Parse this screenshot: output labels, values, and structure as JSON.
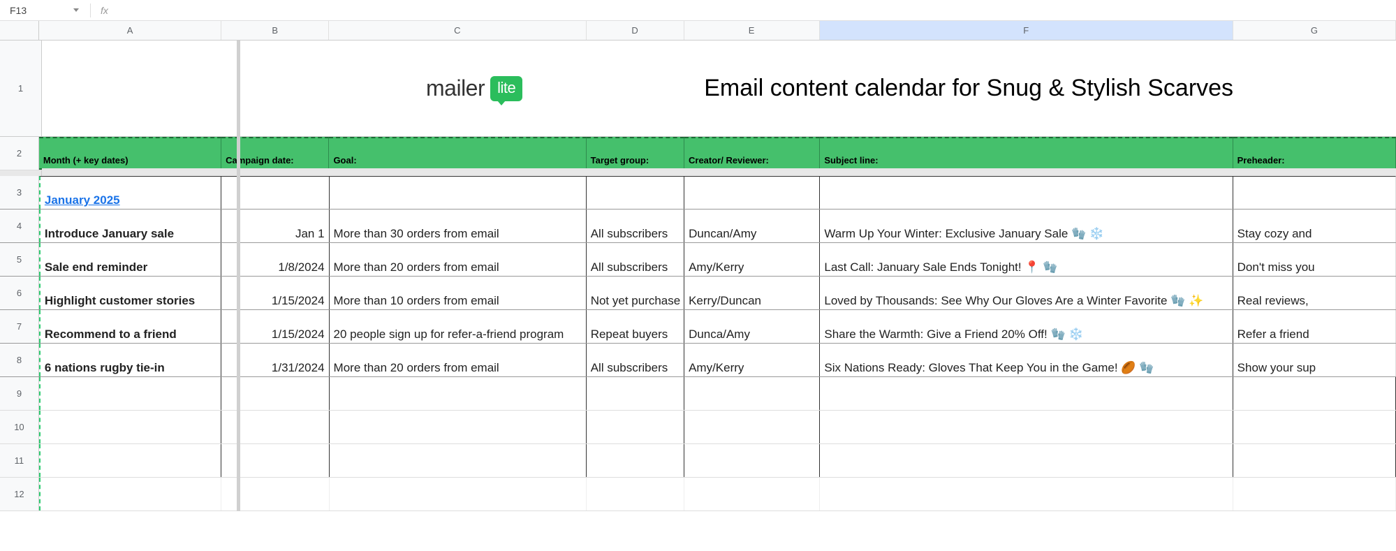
{
  "name_box": "F13",
  "fx_value": "",
  "columns": [
    "A",
    "B",
    "C",
    "D",
    "E",
    "F",
    "G"
  ],
  "selected_column": "F",
  "row_numbers": [
    1,
    2,
    3,
    4,
    5,
    6,
    7,
    8,
    9,
    10,
    11,
    12
  ],
  "title_text": "Email content calendar for Snug & Stylish Scarves",
  "logo": {
    "text_a": "mailer",
    "text_b": "lite"
  },
  "headers": {
    "A": "Month (+ key dates)",
    "B": "Campaign date:",
    "C": "Goal:",
    "D": "Target group:",
    "E": "Creator/ Reviewer:",
    "F": "Subject line:",
    "G": "Preheader:"
  },
  "rows": {
    "r3": {
      "A": "January 2025"
    },
    "r4": {
      "A": "Introduce January sale",
      "B": "Jan 1",
      "C": "More than 30 orders from email",
      "D": "All subscribers",
      "E": "Duncan/Amy",
      "F": "Warm Up Your Winter: Exclusive January Sale 🧤 ❄️",
      "G": "Stay cozy and"
    },
    "r5": {
      "A": "Sale end reminder",
      "B": "1/8/2024",
      "C": "More than 20 orders from email",
      "D": "All subscribers",
      "E": "Amy/Kerry",
      "F": "Last Call: January Sale Ends Tonight! 📍 🧤",
      "G": "Don't miss you"
    },
    "r6": {
      "A": "Highlight customer stories",
      "B": "1/15/2024",
      "C": "More than 10 orders from email",
      "D": "Not yet purchase",
      "E": "Kerry/Duncan",
      "F": "Loved by Thousands: See Why Our Gloves Are a Winter Favorite 🧤 ✨",
      "G": "Real reviews,"
    },
    "r7": {
      "A": "Recommend to a friend",
      "B": "1/15/2024",
      "C": "20 people sign up for refer-a-friend program",
      "D": "Repeat buyers",
      "E": "Dunca/Amy",
      "F": "Share the Warmth: Give a Friend 20% Off! 🧤 ❄️",
      "G": "Refer a friend"
    },
    "r8": {
      "A": "6 nations rugby tie-in",
      "B": "1/31/2024",
      "C": "More than 20 orders from email",
      "D": "All subscribers",
      "E": "Amy/Kerry",
      "F": "Six Nations Ready: Gloves That Keep You in the Game! 🏉 🧤",
      "G": "Show your sup"
    }
  }
}
